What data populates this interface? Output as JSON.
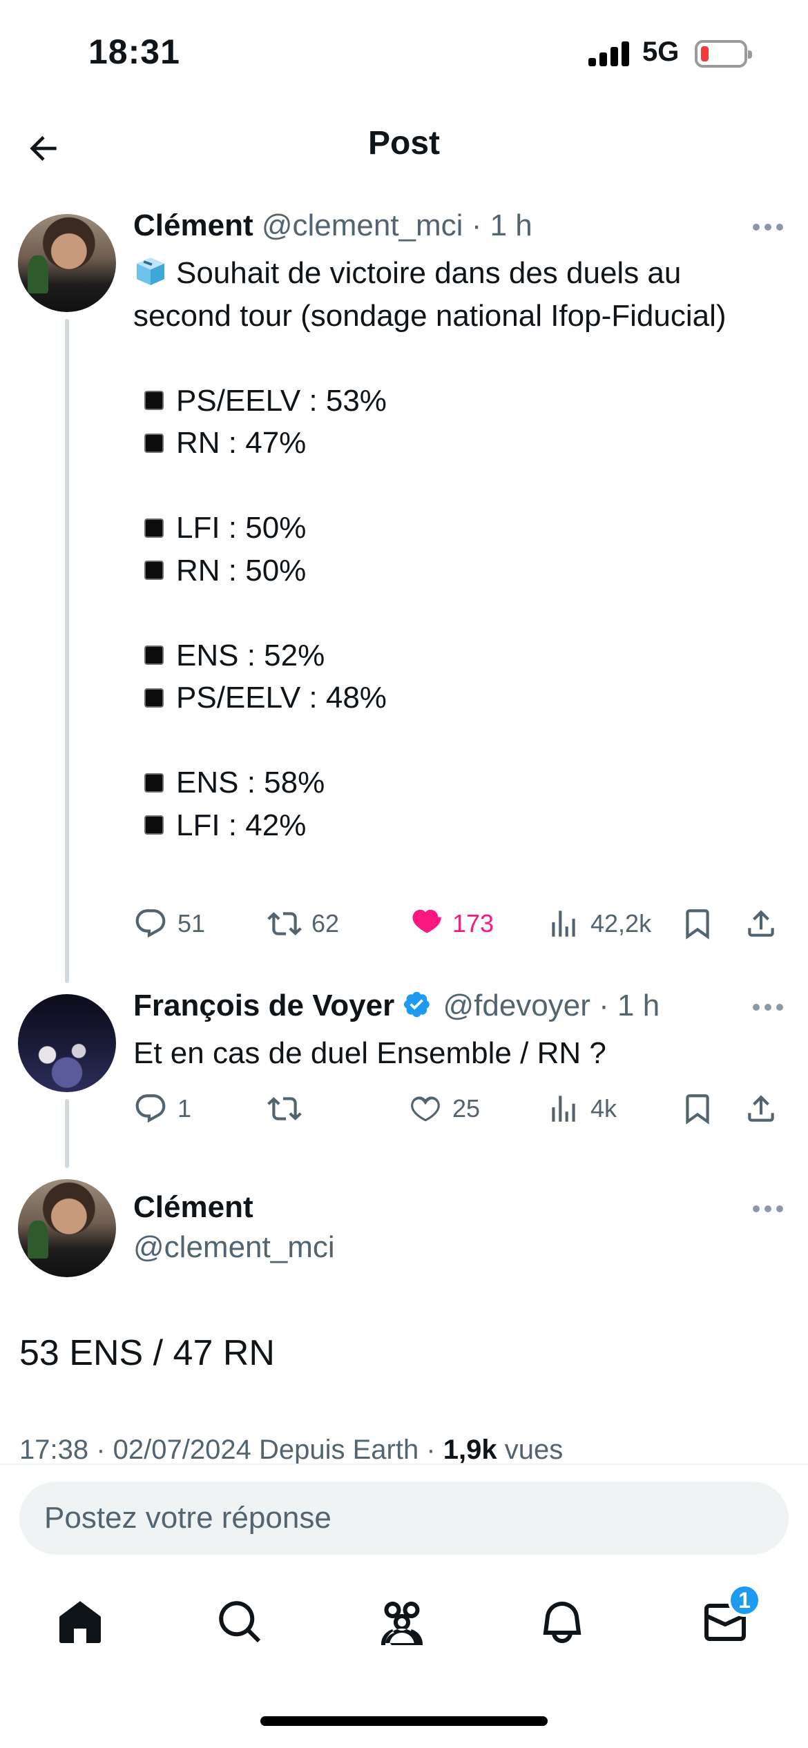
{
  "status_bar": {
    "time": "18:31",
    "network": "5G",
    "battery_level": 0.12
  },
  "header": {
    "title": "Post"
  },
  "tweets": [
    {
      "name": "Clément",
      "handle": "@clement_mci",
      "separator": "·",
      "time": "1 h",
      "intro": "Souhait de victoire dans des duels au second tour (sondage national Ifop-Fiducial)",
      "intro_icon": "ballot-box-icon",
      "poll": [
        "PS/EELV : 53%",
        "RN : 47%",
        "LFI : 50%",
        "RN : 50%",
        "ENS : 52%",
        "PS/EELV : 48%",
        "ENS : 58%",
        "LFI : 42%"
      ],
      "replies": "51",
      "retweets": "62",
      "likes": "173",
      "views": "42,2k",
      "liked": true
    },
    {
      "name": "François de Voyer",
      "verified": true,
      "handle": "@fdevoyer",
      "separator": "·",
      "time": "1 h",
      "text": "Et en cas de duel Ensemble / RN ?",
      "replies": "1",
      "retweets": "",
      "likes": "25",
      "views": "4k"
    }
  ],
  "main_post": {
    "name": "Clément",
    "handle": "@clement_mci",
    "text": "53 ENS / 47 RN",
    "timestamp": "17:38 · 02/07/2024 Depuis Earth ·",
    "views_count": "1,9k",
    "views_label": "vues"
  },
  "reply": {
    "placeholder": "Postez votre réponse"
  },
  "tabbar": {
    "items": [
      "home-icon",
      "search-icon",
      "communities-icon",
      "notifications-icon",
      "messages-icon"
    ],
    "messages_badge": "1"
  },
  "colors": {
    "like": "#f91880",
    "accent": "#1d9bf0",
    "muted": "#536471"
  }
}
